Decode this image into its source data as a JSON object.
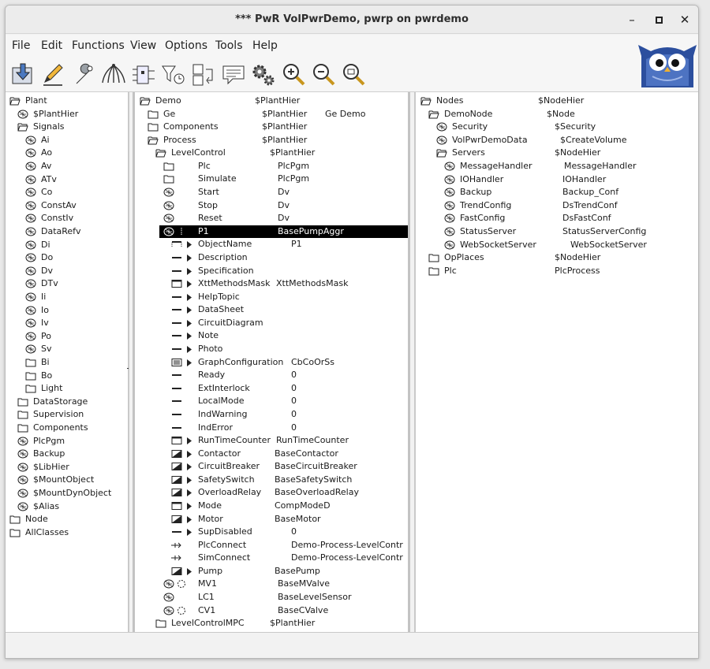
{
  "window": {
    "title": "*** PwR VolPwrDemo,   pwrp on pwrdemo"
  },
  "menu": [
    "File",
    "Edit",
    "Functions",
    "View",
    "Options",
    "Tools",
    "Help"
  ],
  "toolbar": [
    {
      "icon": "import-icon"
    },
    {
      "icon": "edit-pencil-icon"
    },
    {
      "icon": "wrench-icon"
    },
    {
      "icon": "hierarchy-icon"
    },
    {
      "icon": "plc-icon"
    },
    {
      "icon": "filter-icon"
    },
    {
      "icon": "swap-icon"
    },
    {
      "icon": "help-balloon-icon"
    },
    {
      "icon": "gears-icon"
    },
    {
      "icon": "zoom-in-icon"
    },
    {
      "icon": "zoom-out-icon"
    },
    {
      "icon": "zoom-reset-icon"
    }
  ],
  "plant_tree": [
    {
      "name": "Plant",
      "icon": "open-folder",
      "level": 0
    },
    {
      "name": "$PlantHier",
      "icon": "object",
      "level": 1
    },
    {
      "name": "Signals",
      "icon": "open-folder",
      "level": 1
    },
    {
      "name": "Ai",
      "icon": "object",
      "level": 2
    },
    {
      "name": "Ao",
      "icon": "object",
      "level": 2
    },
    {
      "name": "Av",
      "icon": "object",
      "level": 2
    },
    {
      "name": "ATv",
      "icon": "object",
      "level": 2
    },
    {
      "name": "Co",
      "icon": "object",
      "level": 2
    },
    {
      "name": "ConstAv",
      "icon": "object",
      "level": 2
    },
    {
      "name": "ConstIv",
      "icon": "object",
      "level": 2
    },
    {
      "name": "DataRefv",
      "icon": "object",
      "level": 2
    },
    {
      "name": "Di",
      "icon": "object",
      "level": 2
    },
    {
      "name": "Do",
      "icon": "object",
      "level": 2
    },
    {
      "name": "Dv",
      "icon": "object",
      "level": 2
    },
    {
      "name": "DTv",
      "icon": "object",
      "level": 2
    },
    {
      "name": "Ii",
      "icon": "object",
      "level": 2
    },
    {
      "name": "Io",
      "icon": "object",
      "level": 2
    },
    {
      "name": "Iv",
      "icon": "object",
      "level": 2
    },
    {
      "name": "Po",
      "icon": "object",
      "level": 2
    },
    {
      "name": "Sv",
      "icon": "object",
      "level": 2
    },
    {
      "name": "Bi",
      "icon": "folder",
      "level": 2
    },
    {
      "name": "Bo",
      "icon": "folder",
      "level": 2
    },
    {
      "name": "Light",
      "icon": "folder",
      "level": 2
    },
    {
      "name": "DataStorage",
      "icon": "folder",
      "level": 1
    },
    {
      "name": "Supervision",
      "icon": "folder",
      "level": 1
    },
    {
      "name": "Components",
      "icon": "folder",
      "level": 1
    },
    {
      "name": "PlcPgm",
      "icon": "object",
      "level": 1
    },
    {
      "name": "Backup",
      "icon": "object",
      "level": 1
    },
    {
      "name": "$LibHier",
      "icon": "object",
      "level": 1
    },
    {
      "name": "$MountObject",
      "icon": "object",
      "level": 1
    },
    {
      "name": "$MountDynObject",
      "icon": "object",
      "level": 1
    },
    {
      "name": "$Alias",
      "icon": "object",
      "level": 1
    },
    {
      "name": "Node",
      "icon": "folder",
      "level": 0
    },
    {
      "name": "AllClasses",
      "icon": "folder",
      "level": 0
    }
  ],
  "object_tree": [
    {
      "name": "Demo",
      "cls": "$PlantHier",
      "desc": "",
      "icon": "open-folder",
      "level": 0
    },
    {
      "name": "Ge",
      "cls": "$PlantHier",
      "desc": "Ge Demo",
      "icon": "folder",
      "level": 1
    },
    {
      "name": "Components",
      "cls": "$PlantHier",
      "desc": "",
      "icon": "folder",
      "level": 1
    },
    {
      "name": "Process",
      "cls": "$PlantHier",
      "desc": "",
      "icon": "open-folder",
      "level": 1
    },
    {
      "name": "LevelControl",
      "cls": "$PlantHier",
      "desc": "",
      "icon": "open-folder",
      "level": 2
    },
    {
      "name": "Plc",
      "cls": "PlcPgm",
      "desc": "",
      "icon": "folder",
      "level": 3
    },
    {
      "name": "Simulate",
      "cls": "PlcPgm",
      "desc": "",
      "icon": "folder",
      "level": 3
    },
    {
      "name": "Start",
      "cls": "Dv",
      "desc": "",
      "icon": "object",
      "level": 3
    },
    {
      "name": "Stop",
      "cls": "Dv",
      "desc": "",
      "icon": "object",
      "level": 3
    },
    {
      "name": "Reset",
      "cls": "Dv",
      "desc": "",
      "icon": "object",
      "level": 3
    },
    {
      "name": "P1",
      "cls": "BasePumpAggr",
      "desc": "",
      "icon": "object-open",
      "level": 3,
      "selected": true
    },
    {
      "name": "ObjectName",
      "cls": "P1",
      "desc": "",
      "icon": "attr-ref",
      "level": 4,
      "arrow": true
    },
    {
      "name": "Description",
      "cls": "",
      "desc": "",
      "icon": "attr",
      "level": 4,
      "arrow": true
    },
    {
      "name": "Specification",
      "cls": "",
      "desc": "",
      "icon": "attr",
      "level": 4,
      "arrow": true
    },
    {
      "name": "XttMethodsMask",
      "cls": "XttMethodsMask",
      "desc": "",
      "icon": "attr-obj",
      "level": 4,
      "arrow": true
    },
    {
      "name": "HelpTopic",
      "cls": "",
      "desc": "",
      "icon": "attr",
      "level": 4,
      "arrow": true
    },
    {
      "name": "DataSheet",
      "cls": "",
      "desc": "",
      "icon": "attr",
      "level": 4,
      "arrow": true
    },
    {
      "name": "CircuitDiagram",
      "cls": "",
      "desc": "",
      "icon": "attr",
      "level": 4,
      "arrow": true
    },
    {
      "name": "Note",
      "cls": "",
      "desc": "",
      "icon": "attr",
      "level": 4,
      "arrow": true
    },
    {
      "name": "Photo",
      "cls": "",
      "desc": "",
      "icon": "attr",
      "level": 4,
      "arrow": true
    },
    {
      "name": "GraphConfiguration",
      "cls": "CbCoOrSs",
      "desc": "",
      "icon": "attr-array",
      "level": 4,
      "arrow": true
    },
    {
      "name": "Ready",
      "cls": "0",
      "desc": "",
      "icon": "attr",
      "level": 4
    },
    {
      "name": "ExtInterlock",
      "cls": "0",
      "desc": "",
      "icon": "attr",
      "level": 4
    },
    {
      "name": "LocalMode",
      "cls": "0",
      "desc": "",
      "icon": "attr",
      "level": 4
    },
    {
      "name": "IndWarning",
      "cls": "0",
      "desc": "",
      "icon": "attr",
      "level": 4
    },
    {
      "name": "IndError",
      "cls": "0",
      "desc": "",
      "icon": "attr",
      "level": 4
    },
    {
      "name": "RunTimeCounter",
      "cls": "RunTimeCounter",
      "desc": "",
      "icon": "attr-obj",
      "level": 4,
      "arrow": true
    },
    {
      "name": "Contactor",
      "cls": "BaseContactor",
      "desc": "",
      "icon": "attr-comp",
      "level": 4,
      "arrow": true
    },
    {
      "name": "CircuitBreaker",
      "cls": "BaseCircuitBreaker",
      "desc": "",
      "icon": "attr-comp",
      "level": 4,
      "arrow": true
    },
    {
      "name": "SafetySwitch",
      "cls": "BaseSafetySwitch",
      "desc": "",
      "icon": "attr-comp",
      "level": 4,
      "arrow": true
    },
    {
      "name": "OverloadRelay",
      "cls": "BaseOverloadRelay",
      "desc": "",
      "icon": "attr-comp",
      "level": 4,
      "arrow": true
    },
    {
      "name": "Mode",
      "cls": "CompModeD",
      "desc": "",
      "icon": "attr-obj",
      "level": 4,
      "arrow": true
    },
    {
      "name": "Motor",
      "cls": "BaseMotor",
      "desc": "",
      "icon": "attr-comp",
      "level": 4,
      "arrow": true
    },
    {
      "name": "SupDisabled",
      "cls": "0",
      "desc": "",
      "icon": "attr",
      "level": 4,
      "arrow": true
    },
    {
      "name": "PlcConnect",
      "cls": "Demo-Process-LevelContr",
      "desc": "",
      "icon": "attr-connect",
      "level": 4
    },
    {
      "name": "SimConnect",
      "cls": "Demo-Process-LevelContr",
      "desc": "",
      "icon": "attr-connect",
      "level": 4
    },
    {
      "name": "Pump",
      "cls": "BasePump",
      "desc": "",
      "icon": "attr-comp",
      "level": 4,
      "arrow": true
    },
    {
      "name": "MV1",
      "cls": "BaseMValve",
      "desc": "",
      "icon": "object-open",
      "level": 3
    },
    {
      "name": "LC1",
      "cls": "BaseLevelSensor",
      "desc": "",
      "icon": "object",
      "level": 3
    },
    {
      "name": "CV1",
      "cls": "BaseCValve",
      "desc": "",
      "icon": "object-open",
      "level": 3
    },
    {
      "name": "LevelControlMPC",
      "cls": "$PlantHier",
      "desc": "",
      "icon": "folder",
      "level": 2
    }
  ],
  "node_tree": [
    {
      "name": "Nodes",
      "cls": "$NodeHier",
      "icon": "open-folder",
      "level": 0
    },
    {
      "name": "DemoNode",
      "cls": "$Node",
      "icon": "open-folder",
      "level": 1
    },
    {
      "name": "Security",
      "cls": "$Security",
      "icon": "object",
      "level": 2
    },
    {
      "name": "VolPwrDemoData",
      "cls": "$CreateVolume",
      "icon": "object",
      "level": 2
    },
    {
      "name": "Servers",
      "cls": "$NodeHier",
      "icon": "open-folder",
      "level": 2
    },
    {
      "name": "MessageHandler",
      "cls": "MessageHandler",
      "icon": "object",
      "level": 3
    },
    {
      "name": "IOHandler",
      "cls": "IOHandler",
      "icon": "object",
      "level": 3
    },
    {
      "name": "Backup",
      "cls": "Backup_Conf",
      "icon": "object",
      "level": 3
    },
    {
      "name": "TrendConfig",
      "cls": "DsTrendConf",
      "icon": "object",
      "level": 3
    },
    {
      "name": "FastConfig",
      "cls": "DsFastConf",
      "icon": "object",
      "level": 3
    },
    {
      "name": "StatusServer",
      "cls": "StatusServerConfig",
      "icon": "object",
      "level": 3
    },
    {
      "name": "WebSocketServer",
      "cls": "WebSocketServer",
      "icon": "object",
      "level": 3
    },
    {
      "name": "OpPlaces",
      "cls": "$NodeHier",
      "icon": "folder",
      "level": 1
    },
    {
      "name": "Plc",
      "cls": "PlcProcess",
      "icon": "folder",
      "level": 1
    }
  ]
}
